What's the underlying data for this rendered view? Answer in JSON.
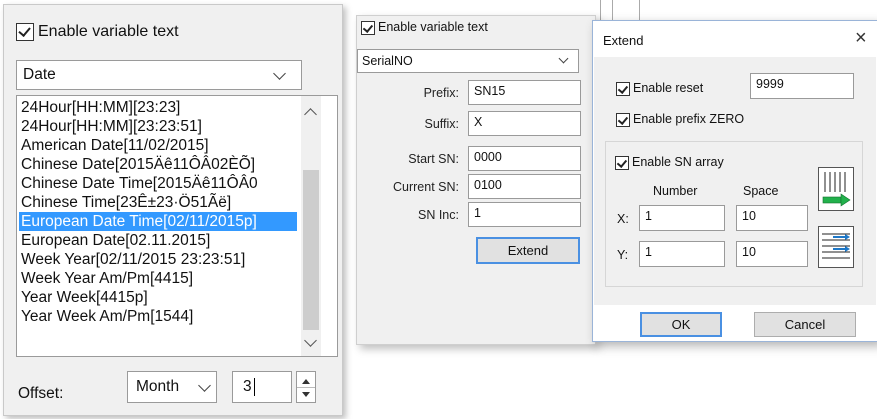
{
  "left_panel": {
    "enable_label": "Enable variable text",
    "enable_checked": true,
    "format_select": "Date",
    "list_items": [
      "24Hour[HH:MM][23:23]",
      "24Hour[HH:MM][23:23:51]",
      "American Date[11/02/2015]",
      "Chinese Date[2015Äê11ÔÂ02ÈÕ]",
      "Chinese Date Time[2015Äê11ÔÂ0",
      "Chinese Time[23Ê±23·Ö51Ãë]",
      "European Date Time[02/11/2015p]",
      "European Date[02.11.2015]",
      "Week Year[02/11/2015 23:23:51]",
      "Week Year Am/Pm[4415]",
      "Year Week[4415p]",
      "Year Week Am/Pm[1544]"
    ],
    "selected_index": 6,
    "offset_label": "Offset:",
    "offset_unit": "Month",
    "offset_value": "3"
  },
  "middle_panel": {
    "enable_label": "Enable variable text",
    "enable_checked": true,
    "type_select": "SerialNO",
    "fields": {
      "prefix_label": "Prefix:",
      "prefix_value": "SN15",
      "suffix_label": "Suffix:",
      "suffix_value": "X",
      "start_label": "Start SN:",
      "start_value": "0000",
      "current_label": "Current SN:",
      "current_value": "0100",
      "inc_label": "SN Inc:",
      "inc_value": "1"
    },
    "extend_button": "Extend"
  },
  "dialog": {
    "title": "Extend",
    "close": "×",
    "enable_reset_label": "Enable reset",
    "enable_reset_checked": true,
    "reset_value": "9999",
    "enable_prefix_zero_label": "Enable prefix ZERO",
    "enable_prefix_zero_checked": true,
    "enable_sn_array_label": "Enable SN array",
    "enable_sn_array_checked": true,
    "number_header": "Number",
    "space_header": "Space",
    "x_label": "X:",
    "x_number": "1",
    "x_space": "10",
    "y_label": "Y:",
    "y_number": "1",
    "y_space": "10",
    "ok": "OK",
    "cancel": "Cancel"
  },
  "colors": {
    "selection": "#3399ff",
    "panel_bg": "#f0f0f0",
    "arrow_green": "#22b14c",
    "arrow_blue": "#1e78c8",
    "default_button_border": "#4a90e2"
  }
}
